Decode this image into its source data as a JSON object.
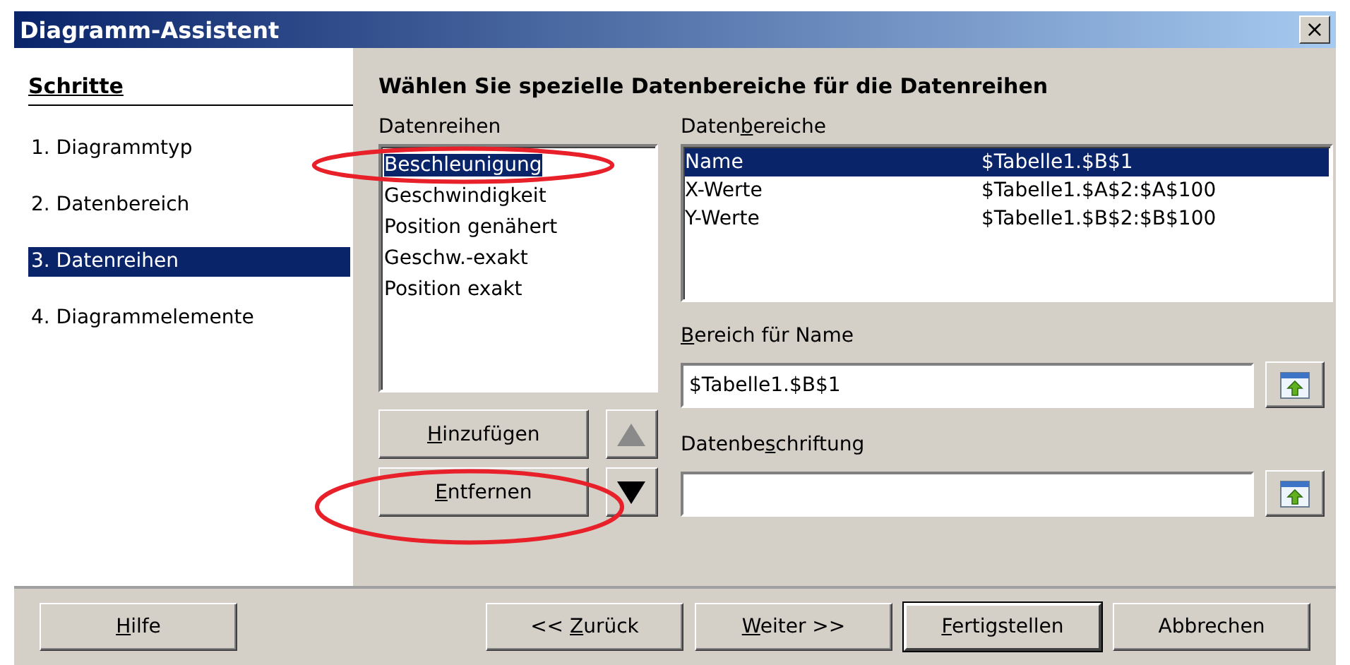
{
  "window": {
    "title": "Diagramm-Assistent",
    "close": "×"
  },
  "steps": {
    "heading": "Schritte",
    "items": [
      {
        "label": "1. Diagrammtyp",
        "selected": false
      },
      {
        "label": "2. Datenbereich",
        "selected": false
      },
      {
        "label": "3. Datenreihen",
        "selected": true
      },
      {
        "label": "4. Diagrammelemente",
        "selected": false
      }
    ]
  },
  "heading": "Wählen Sie spezielle Datenbereiche für die Datenreihen",
  "series": {
    "label": "Datenreihen",
    "items": [
      {
        "label": "Beschleunigung",
        "selected": true,
        "circled": true
      },
      {
        "label": "Geschwindigkeit",
        "selected": false,
        "circled": false
      },
      {
        "label": "Position genähert",
        "selected": false,
        "circled": false
      },
      {
        "label": "Geschw.-exakt",
        "selected": false,
        "circled": false
      },
      {
        "label": "Position exakt",
        "selected": false,
        "circled": false
      }
    ],
    "buttons": [
      {
        "key": "H",
        "post": "inzufügen",
        "circled": false
      },
      {
        "key": "E",
        "post": "ntfernen",
        "circled": true
      }
    ],
    "move": [
      {
        "kind": "up",
        "disabled": true
      },
      {
        "kind": "down",
        "disabled": false
      }
    ]
  },
  "ranges": {
    "label": {
      "pre": "Daten",
      "key": "b",
      "post": "ereiche"
    },
    "rows": [
      {
        "role": "Name",
        "range": "$Tabelle1.$B$1",
        "selected": true
      },
      {
        "role": "X-Werte",
        "range": "$Tabelle1.$A$2:$A$100",
        "selected": false
      },
      {
        "role": "Y-Werte",
        "range": "$Tabelle1.$B$2:$B$100",
        "selected": false
      }
    ]
  },
  "fields": [
    {
      "label": {
        "key": "B",
        "post": "ereich für Name"
      },
      "value": "$Tabelle1.$B$1"
    },
    {
      "label": {
        "pre": "Datenbe",
        "key": "s",
        "post": "chriftung"
      }
    }
  ],
  "footer": [
    {
      "key": "H",
      "post": "ilfe",
      "default": false
    },
    {
      "pre": "<< ",
      "key": "Z",
      "post": "urück",
      "default": false
    },
    {
      "key": "W",
      "post": "eiter >>",
      "default": false
    },
    {
      "key": "F",
      "post": "ertigstellen",
      "default": true
    },
    {
      "pre": "Abbrechen",
      "default": false
    }
  ]
}
